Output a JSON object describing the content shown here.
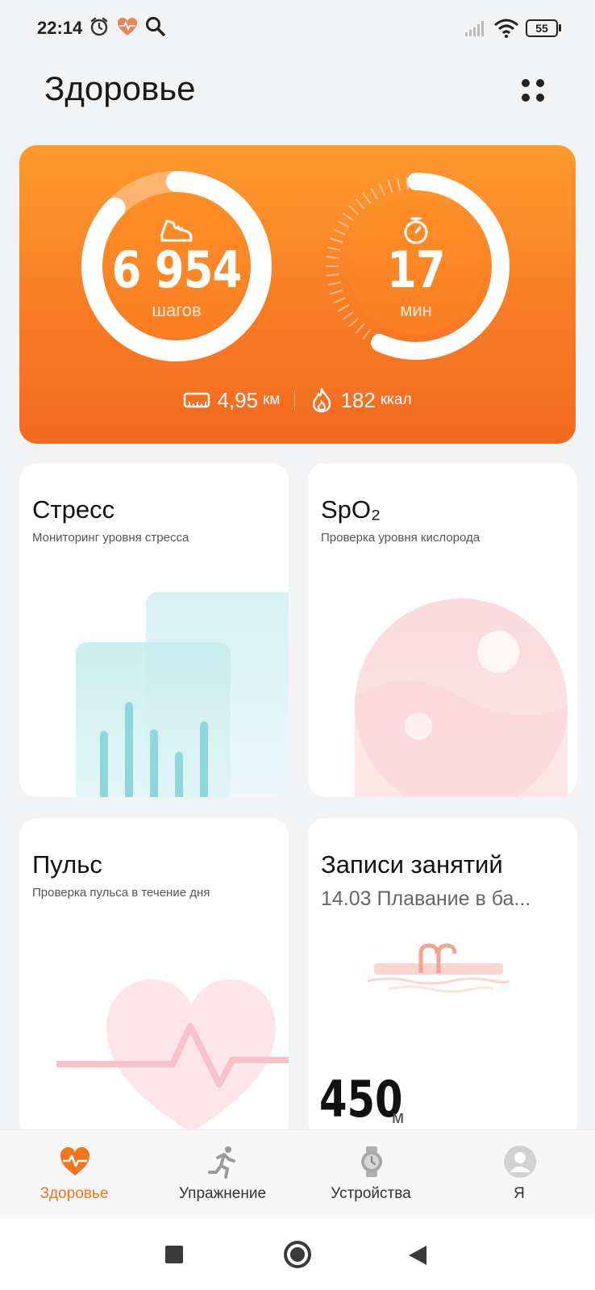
{
  "status_bar": {
    "time": "22:14",
    "battery": "55",
    "icons": [
      "alarm-icon",
      "health-app-icon",
      "search-icon",
      "signal-icon",
      "wifi-icon",
      "battery-icon"
    ]
  },
  "header": {
    "title": "Здоровье",
    "menu_icon": "four-dots-icon"
  },
  "activity": {
    "steps_value": "6 954",
    "steps_unit": "шагов",
    "steps_progress": 0.87,
    "minutes_value": "17",
    "minutes_unit": "мин",
    "minutes_progress": 0.57,
    "distance_value": "4,95",
    "distance_unit": "км",
    "calories_value": "182",
    "calories_unit": "ккал",
    "colors": {
      "card_top": "#ff9a2e",
      "card_bottom": "#f36a22"
    }
  },
  "tiles": {
    "stress": {
      "title": "Стресс",
      "subtitle": "Мониторинг уровня стресса"
    },
    "spo2": {
      "title": "SpO₂",
      "subtitle": "Проверка уровня кислорода"
    },
    "pulse": {
      "title": "Пульс",
      "subtitle": "Проверка пульса в течение дня"
    },
    "workouts": {
      "title": "Записи занятий",
      "subtitle": "14.03 Плавание в ба...",
      "value": "450",
      "unit": "м"
    }
  },
  "bottom_nav": {
    "items": [
      {
        "label": "Здоровье",
        "icon": "heart-pulse-icon",
        "active": true
      },
      {
        "label": "Упражнение",
        "icon": "runner-icon",
        "active": false
      },
      {
        "label": "Устройства",
        "icon": "watch-icon",
        "active": false
      },
      {
        "label": "Я",
        "icon": "avatar-icon",
        "active": false
      }
    ],
    "accent": "#f4741d"
  },
  "system_nav": {
    "icons": [
      "recents-square-icon",
      "home-circle-icon",
      "back-triangle-icon"
    ]
  }
}
